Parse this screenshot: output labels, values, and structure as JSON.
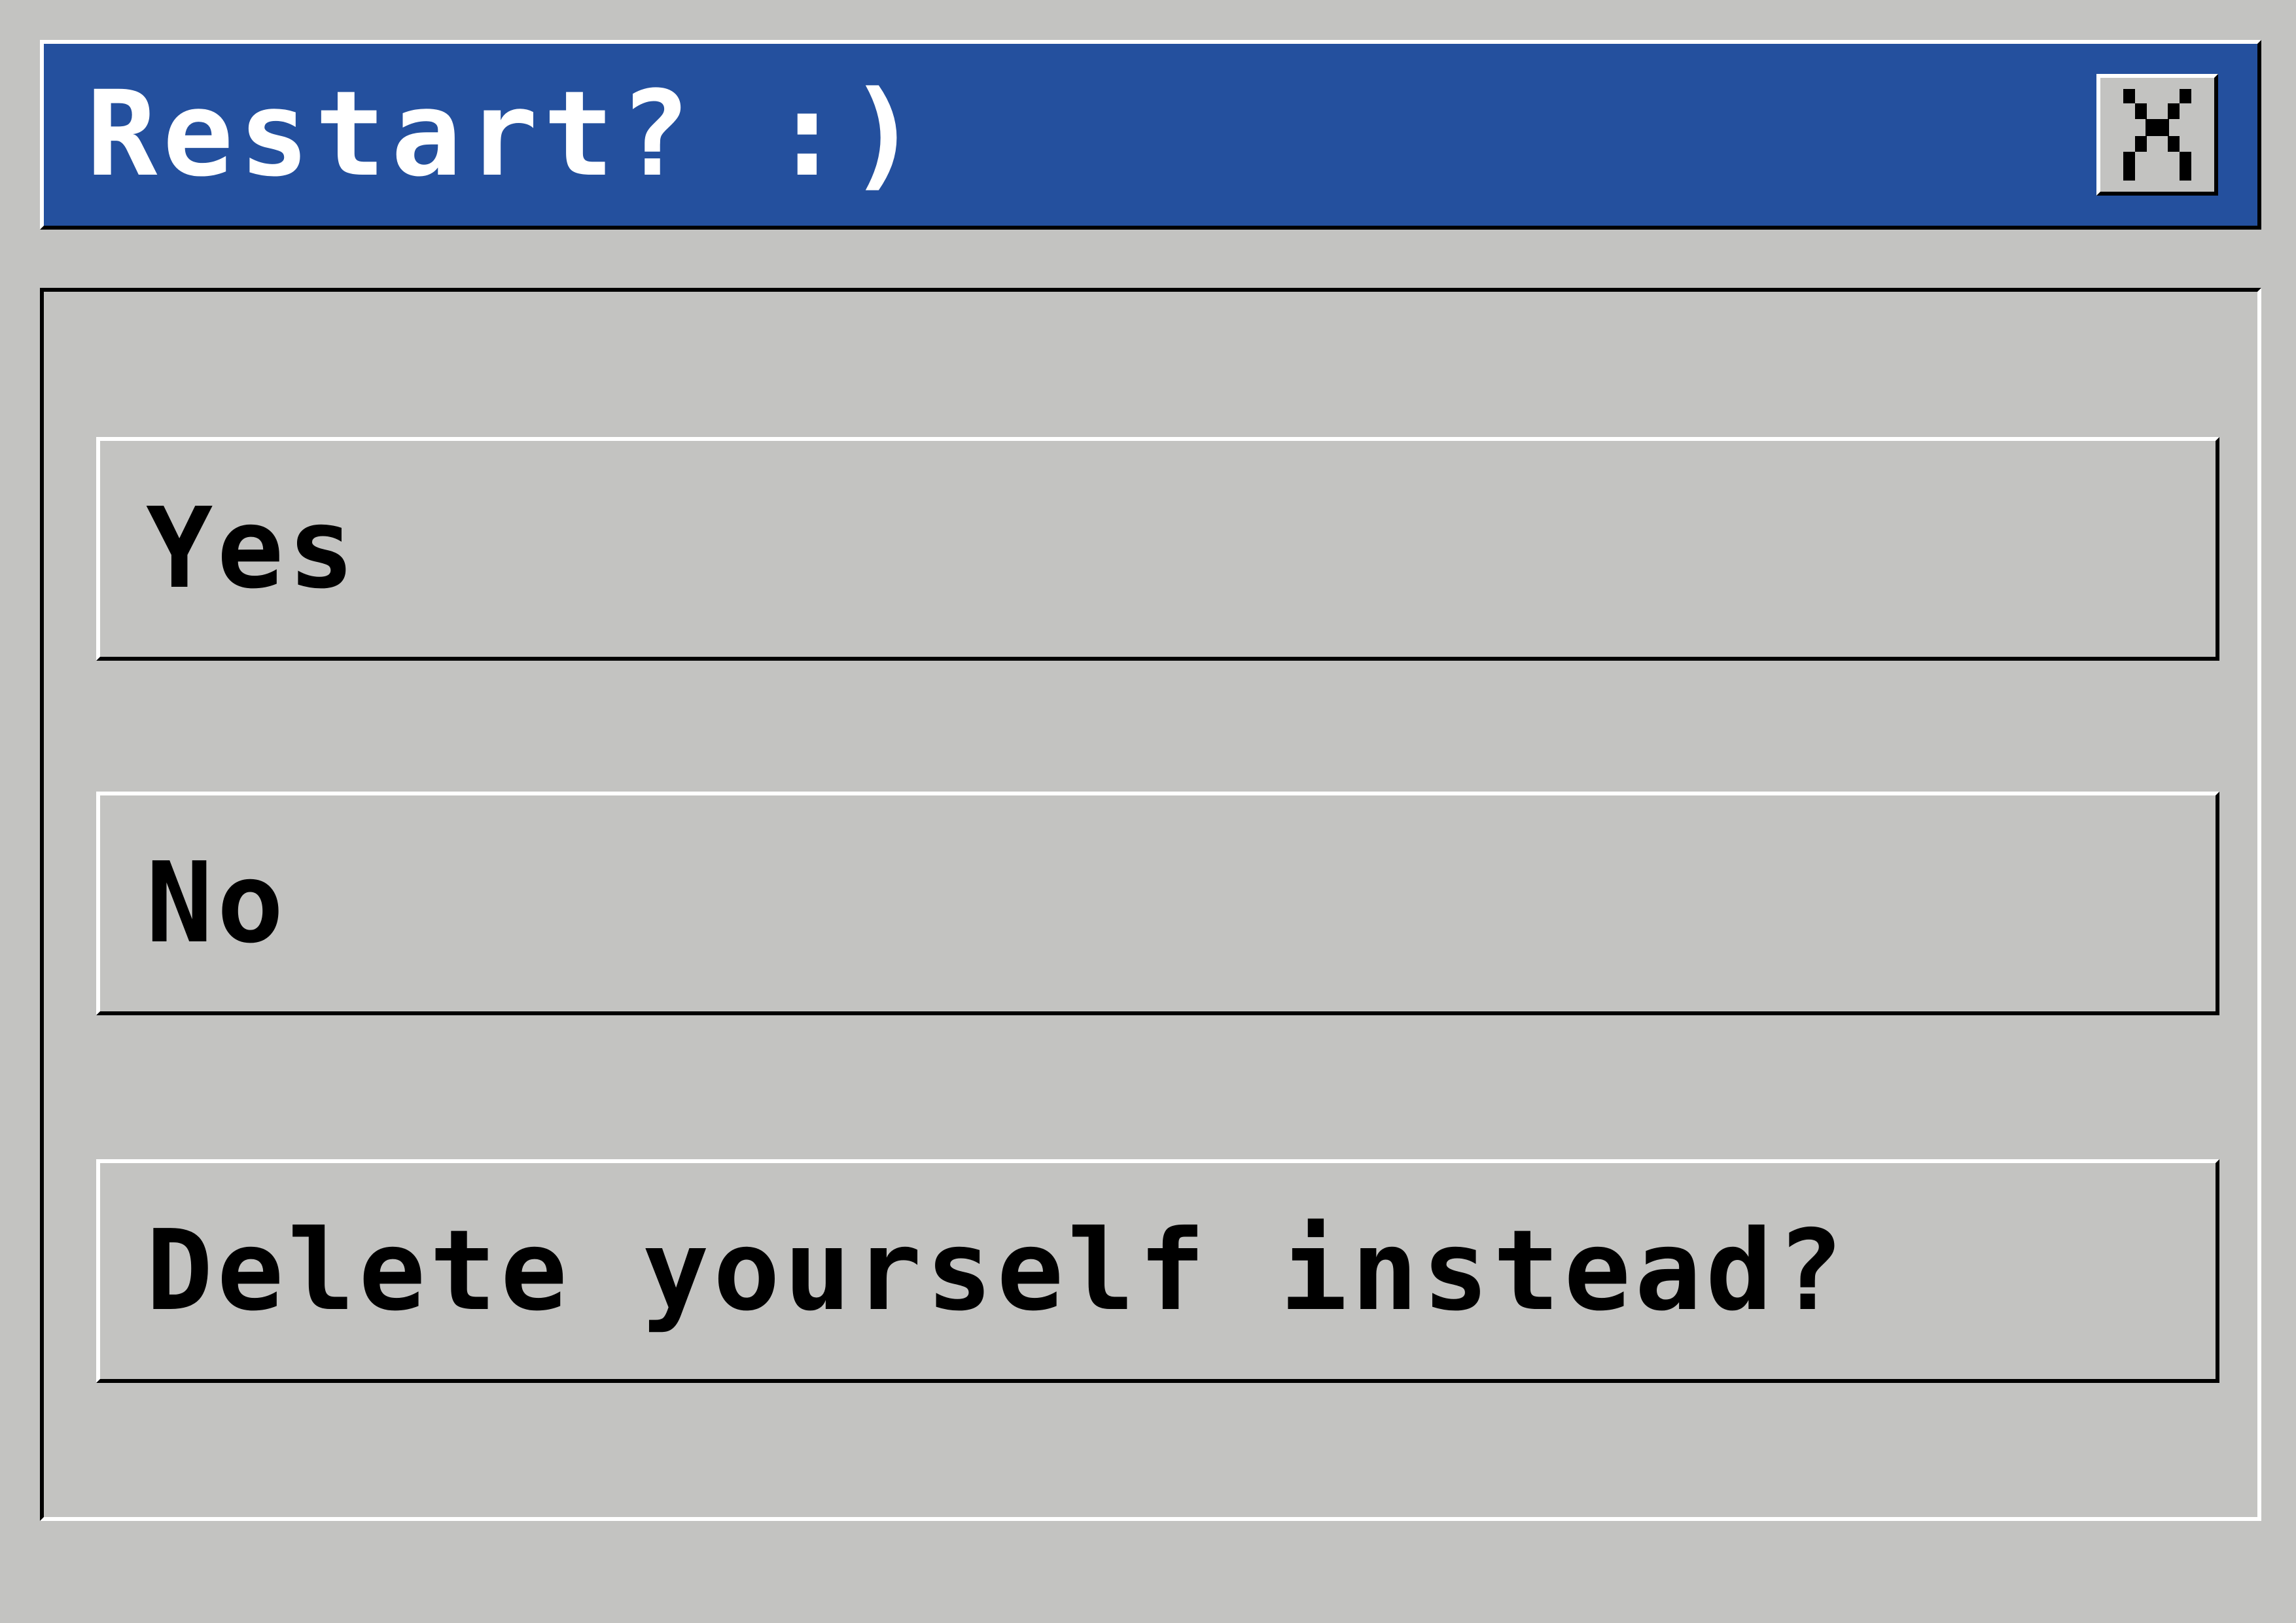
{
  "window": {
    "title": "Restart? :)",
    "close_label": "X"
  },
  "options": [
    {
      "label": "Yes"
    },
    {
      "label": "No"
    },
    {
      "label": "Delete yourself instead?"
    }
  ],
  "colors": {
    "titlebar_background": "#24509e",
    "window_background": "#c3c3c1",
    "title_text": "#ffffff",
    "button_text": "#000000",
    "bevel_light": "#ffffff",
    "bevel_dark": "#000000"
  },
  "icons": {
    "close": "close-x-icon"
  }
}
